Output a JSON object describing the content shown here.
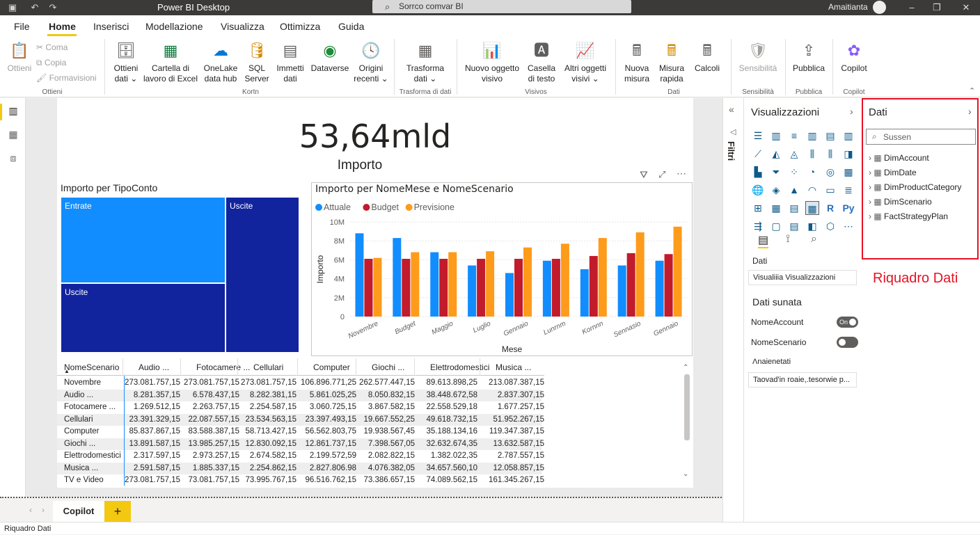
{
  "titlebar": {
    "title": "Power BI Desktop",
    "search": "Sorrco comvar BI",
    "user": "Amaitianta"
  },
  "menu": [
    "File",
    "Home",
    "Inserisci",
    "Modellazione",
    "Visualizza",
    "Ottimizza",
    "Guida"
  ],
  "ribbon": {
    "ottieni": "Ottieni",
    "coma": "Coma",
    "copia": "Copia",
    "formavisioni": "Formavisioni",
    "group_ottieni": "Ottieni",
    "ottieni_dati": [
      "Ottieni",
      "dati ⌄"
    ],
    "cartella": [
      "Cartella di",
      "lavoro di Excel"
    ],
    "onelake": [
      "OneLake",
      "data hub"
    ],
    "sql": [
      "SQL",
      "Server"
    ],
    "immetti": [
      "Immetti",
      "dati"
    ],
    "dataverse": "Dataverse",
    "origini": [
      "Origini",
      "recenti ⌄"
    ],
    "group_kortn": "Kortn",
    "trasforma": [
      "Trasforma",
      "dati ⌄"
    ],
    "group_trasforma": "Trasforma di dati",
    "nuovo_oggetto": [
      "Nuovo oggetto",
      "visivo"
    ],
    "casella": [
      "Casella",
      "di testo"
    ],
    "altri": [
      "Altri oggetti",
      "visivi ⌄"
    ],
    "group_visivos": "Visivos",
    "nuova_misura": [
      "Nuova",
      "misura"
    ],
    "misura_rapida": [
      "Misura",
      "rapida"
    ],
    "calcoli": "Calcoli",
    "group_dati": "Dati",
    "sensibilita": "Sensibilità",
    "group_sensibilita": "Sensibilità",
    "pubblica": "Pubblica",
    "group_pubblica": "Pubblica",
    "copilot": "Copilot",
    "group_copilot": "Copilot"
  },
  "kpi": {
    "value": "53,64mld",
    "label": "Importo"
  },
  "treemap": {
    "title": "Importo per TipoConto",
    "labels": [
      "Entrate",
      "Uscite",
      "Uscite"
    ]
  },
  "chart_data": {
    "type": "bar",
    "title": "Importo per NomeMese e NomeScenario",
    "xlabel": "Mese",
    "ylabel": "Importo",
    "categories": [
      "Novembre",
      "Budget",
      "Maggio",
      "Luglio",
      "Gennaio",
      "Lunrnm",
      "Kornnn",
      "Sennasio",
      "Gennaio"
    ],
    "yticks": [
      "10M",
      "8M",
      "6M",
      "4M",
      "2M",
      "0"
    ],
    "ylim": [
      0,
      10
    ],
    "series": [
      {
        "name": "Attuale",
        "color": "#118dff",
        "values": [
          8.8,
          8.3,
          6.8,
          5.4,
          4.6,
          5.9,
          5.0,
          5.4,
          5.9
        ]
      },
      {
        "name": "Budget",
        "color": "#c21b2b",
        "values": [
          6.1,
          6.1,
          6.1,
          6.1,
          6.1,
          6.1,
          6.4,
          6.7,
          6.6
        ]
      },
      {
        "name": "Previsione",
        "color": "#fe9b1b",
        "values": [
          6.2,
          6.8,
          6.8,
          6.9,
          7.3,
          7.7,
          8.3,
          8.9,
          9.5
        ]
      }
    ]
  },
  "table": {
    "headers": [
      "NomeScenario",
      "Audio ...",
      "Fotocamere ...",
      "Cellulari",
      "Computer",
      "Giochi ...",
      "Elettrodomestici",
      "Musica ..."
    ],
    "rows": [
      [
        "Novembre",
        "273.081.757,15",
        "273.081.757,15",
        "273.081.757,15",
        "106.896.771,25",
        "262.577.447,15",
        "89.613.898,25",
        "213.087.387,15"
      ],
      [
        "Audio ...",
        "8.281.357,15",
        "6.578.437,15",
        "8.282.381,15",
        "5.861.025,25",
        "8.050.832,15",
        "38.448.672,58",
        "2.837.307,15"
      ],
      [
        "Fotocamere ...",
        "1.269.512,15",
        "2.263.757,15",
        "2.254.587,15",
        "3.060.725,15",
        "3.867.582,15",
        "22.558.529,18",
        "1.677.257,15"
      ],
      [
        "Cellulari",
        "23.391.329,15",
        "22.087.557,15",
        "23.534.563,15",
        "23.397.493,15",
        "19.667.552,25",
        "49.618.732,15",
        "51.952.267,15"
      ],
      [
        "Computer",
        "85.837.867,15",
        "83.588.387,15",
        "58.713.427,15",
        "56.562.803,75",
        "19.938.567,45",
        "35.188.134,16",
        "119.347.387,15"
      ],
      [
        "Giochi ...",
        "13.891.587,15",
        "13.985.257,15",
        "12.830.092,15",
        "12.861.737,15",
        "7.398.567,05",
        "32.632.674,35",
        "13.632.587,15"
      ],
      [
        "Elettrodomestici",
        "2.317.597,15",
        "2.973.257,15",
        "2.674.582,15",
        "2.199.572,59",
        "2.082.822,15",
        "1.382.022,35",
        "2.787.557,15"
      ],
      [
        "Musica ...",
        "2.591.587,15",
        "1.885.337,15",
        "2.254.862,15",
        "2.827.806.98",
        "4.076.382,05",
        "34.657.560,10",
        "12.058.857,15"
      ],
      [
        "TV e Video",
        "273.081.757,15",
        "73.081.757,15",
        "73.995.767,15",
        "96.516.762,15",
        "73.386.657,15",
        "74.089.562,15",
        "161.345.267,15"
      ]
    ]
  },
  "filtri": "Filtri",
  "viz": {
    "title": "Visualizzazioni",
    "dati_label": "Dati",
    "search": "Visualiiia Visualizzazioni",
    "dati_sunata": "Dati sunata",
    "field1": "NomeAccount",
    "field1_toggle": "On",
    "field2": "NomeScenario",
    "field3": "Ʌnaienetati",
    "input2": "Taovad'in roaie,.tesorwie p..."
  },
  "dati": {
    "title": "Dati",
    "search": "Sussen",
    "tables": [
      "DimAccount",
      "DimDate",
      "DimProductCategory",
      "DimScenario",
      "FactStrategyPlan"
    ],
    "annotation": "Riquadro Dati"
  },
  "pages": {
    "tab": "Copilot",
    "add": "+"
  },
  "status": "Riquadro Dati"
}
